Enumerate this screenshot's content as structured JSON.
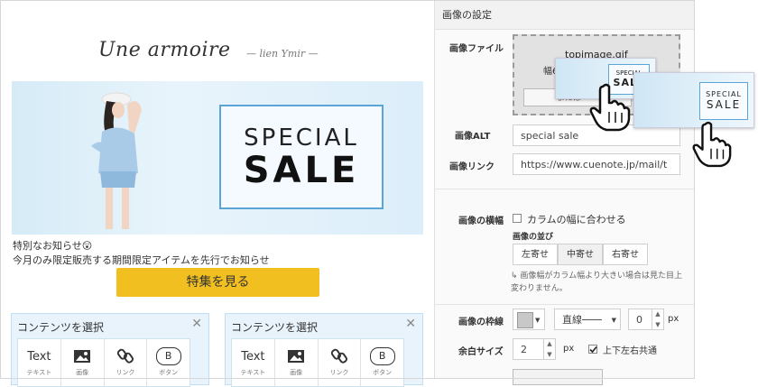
{
  "brand": {
    "name": "Une armoire",
    "sub": "— lien Ymir —"
  },
  "hero": {
    "sale_top": "SPECIAL",
    "sale_bottom": "SALE"
  },
  "notice": {
    "line1": "特別なお知らせ😲",
    "line2": "今月のみ限定販売する期間限定アイテムを先行でお知らせ"
  },
  "cta": {
    "label": "特集を見る"
  },
  "panels": [
    {
      "title": "コンテンツを選択",
      "close": "✕"
    },
    {
      "title": "コンテンツを選択",
      "close": "✕"
    }
  ],
  "tools": [
    {
      "main": "Text",
      "sub": "テキスト",
      "icon": "text-icon"
    },
    {
      "main": "",
      "sub": "画像",
      "icon": "image-icon"
    },
    {
      "main": "",
      "sub": "リンク",
      "icon": "link-icon"
    },
    {
      "main": "B",
      "sub": "ボタン",
      "icon": "button-icon"
    }
  ],
  "settings": {
    "header": "画像の設定",
    "image_file_label": "画像ファイル",
    "file_name": "topimage.gif",
    "file_size": "幅60",
    "file_button": "または",
    "alt_label": "画像ALT",
    "alt_value": "special sale",
    "link_label": "画像リンク",
    "link_value": "https://www.cuenote.jp/mail/t",
    "width_label": "画像の横幅",
    "fit_column": "カラムの幅に合わせる",
    "align_label": "画像の並び",
    "align_left": "左寄せ",
    "align_center": "中寄せ",
    "align_right": "右寄せ",
    "note": "↳ 画像幅がカラム幅より大きい場合は見た目上変わりません。",
    "border_label": "画像の枠線",
    "border_style": "直線",
    "border_width": "0",
    "border_unit": "px",
    "margin_label": "余白サイズ",
    "margin_value": "2",
    "margin_unit": "px",
    "all_sides": "上下左右共通"
  },
  "drag_thumb": {
    "sale_top": "SPECIAL",
    "sale_bottom": "SALE"
  },
  "colors": {
    "accent": "#f2bf21",
    "frame_blue": "#5aa5d6",
    "panel_bg": "#e8f3fb"
  }
}
